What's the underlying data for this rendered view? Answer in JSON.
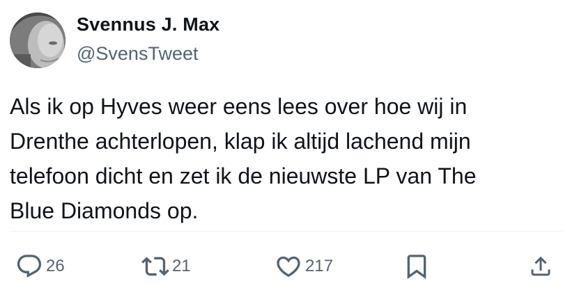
{
  "author": {
    "display_name": "Svennus J. Max",
    "handle": "@SvensTweet"
  },
  "tweet": {
    "text": "Als ik op Hyves weer eens lees over hoe wij in\nDrenthe achterlopen, klap ik altijd lachend mijn\ntelefoon dicht en zet ik de nieuwste LP van The\nBlue Diamonds op."
  },
  "actions": {
    "replies": "26",
    "reposts": "21",
    "likes": "217"
  },
  "icons": {
    "reply": "speech-bubble-icon",
    "repost": "repost-arrows-icon",
    "like": "heart-icon",
    "bookmark": "bookmark-icon",
    "share": "share-upload-icon"
  },
  "colors": {
    "text": "#0f1419",
    "secondary": "#536471",
    "divider": "#eff3f4"
  }
}
